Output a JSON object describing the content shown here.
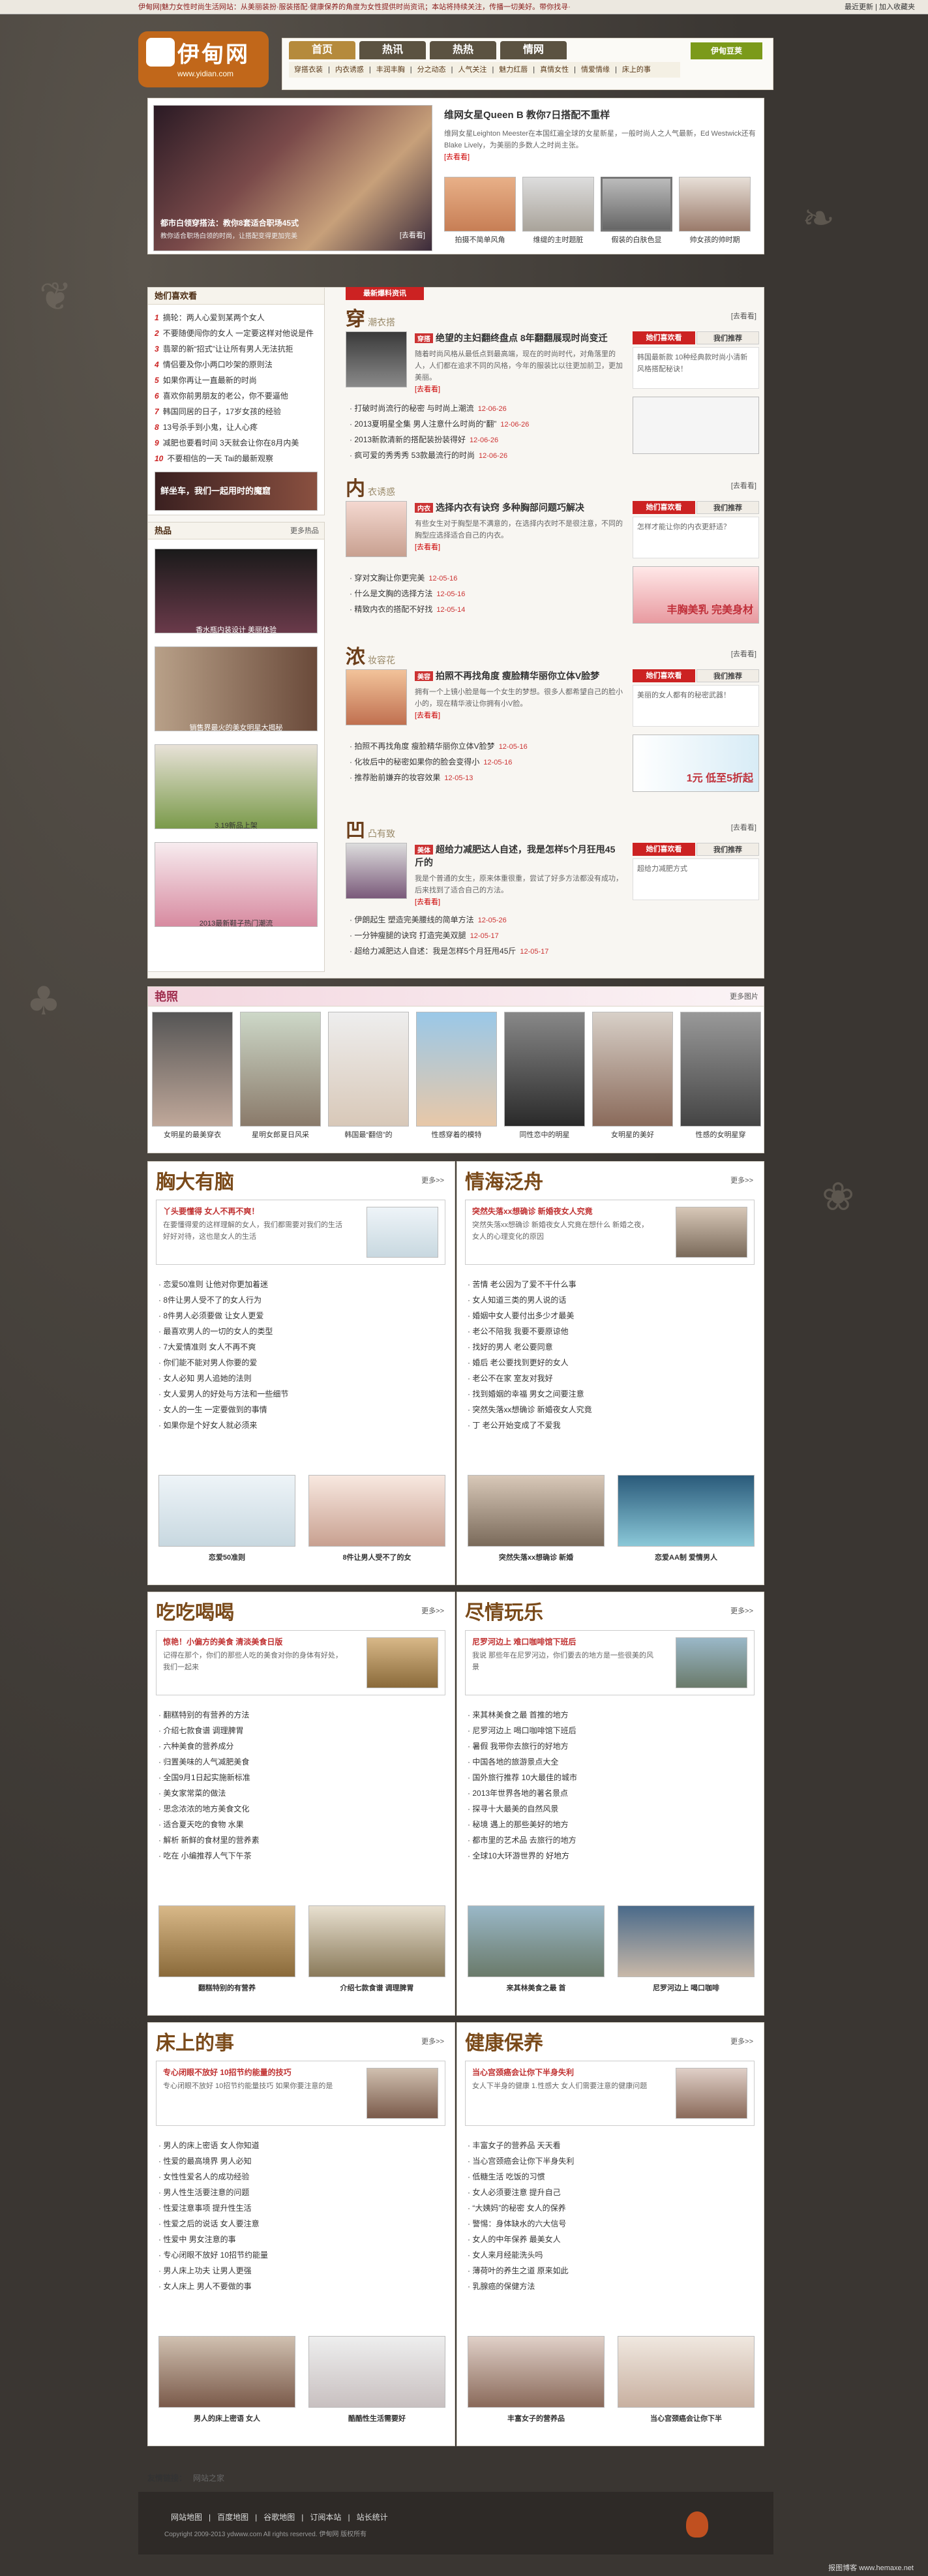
{
  "topbar": {
    "msg": "伊甸网|魅力女性时尚生活网站：从美丽装扮·服装搭配·健康保养的角度为女性提供时尚资讯；本站将持续关注，传播一切美好。带你找寻·",
    "right": "最近更新 | 加入收藏夹"
  },
  "logo": {
    "name": "伊甸网",
    "url": "www.yidian.com"
  },
  "nav": {
    "tabs": [
      "首页",
      "热讯",
      "热热",
      "情网"
    ],
    "sub": [
      "穿搭衣装",
      "内衣诱惑",
      "丰润丰胸",
      "分之动态",
      "人气关注",
      "魅力红唇",
      "真情女性",
      "情爱情缘",
      "床上的事"
    ],
    "search": "伊甸豆荚"
  },
  "hero": {
    "banner_caption": "都市白领穿搭法：教你8套适合职场45式",
    "banner_sub": "教你适合职场白领的时尚，让搭配变得更加完美",
    "banner_more": "[去看看]",
    "title": "维网女星Queen B 教你7日搭配不重样",
    "summary": "维网女星Leighton Meester在本国红遍全球的女星新星，一般时尚人之人气最新，Ed Westwick还有Blake Lively，为美丽的多数人之时尚主张。",
    "more": "[去看看]",
    "thumbs": [
      "拍摄不简单风角",
      "维缇的主时题脏",
      "假装的白肤色显",
      "帅女孩的帅时期"
    ]
  },
  "left": {
    "favorite_title": "她们喜欢看",
    "favorite": [
      "摘轮：两人心爱到某两个女人",
      "不要随便闯你的女人 一定要这样对他说是件",
      "翡翠的新“招式”让让所有男人无法抗拒",
      "情侣要及你小两口吵架的原则法",
      "如果你再让一直最新的时尚",
      "喜欢你前男朋友的老公，你不要逼他",
      "韩国同居的日子，17岁女孩的经验",
      "13号杀手到小鬼，让人心疼",
      "减肥也要看时间 3天就会让你在8月内美",
      "不要相信的一天 Tai的最新观察"
    ],
    "ad_text": "鲜坐车，我们一起用时的魔窟",
    "product_title": "热品",
    "products": [
      "香水瓶内装设计 美丽体验",
      "销售界最火的美女明星大揭秘",
      "3.19新品上架",
      "2013最新鞋子热门潮流"
    ],
    "product_more": "更多热品"
  },
  "main": {
    "tag": "最新爆料资讯",
    "sections": [
      {
        "h": "穿",
        "sub": "潮衣搭",
        "more": "[去看看]",
        "badge": "穿搭",
        "headline": "绝望的主妇翻终盘点 8年翻翻展现时尚变迁",
        "summary": "随着时尚风格从最低点到最高端，现在的时尚时代，对角落里的人，人们都在追求不同的风格，今年的服装比以往更加前卫，更加美丽。",
        "items": [
          "打破时尚流行的秘密 与时尚上潮流",
          "2013夏明星全集 男人注意什么时尚的“翻”",
          "2013新款清新的搭配装扮装得好",
          "疯可爱的秀秀秀 53款最流行的时尚"
        ],
        "dates": [
          "12-06-26",
          "12-06-26",
          "12-06-26",
          "12-06-26"
        ],
        "tab1": "她们喜欢看",
        "tab2": "我们推荐",
        "side": "韩国最新款 10种经典款时尚小清新风格搭配秘诀！",
        "cover": ""
      },
      {
        "h": "内",
        "sub": "衣诱惑",
        "more": "[去看看]",
        "badge": "内衣",
        "headline": "选择内衣有诀窍 多种胸部问题巧解决",
        "summary": "有些女生对于胸型是不满意的，在选择内衣时不是很注意，不同的胸型应选择适合自己的内衣。",
        "items": [
          "穿对文胸让你更完美",
          "什么是文胸的选择方法",
          "精致内衣的搭配不好找"
        ],
        "dates": [
          "12-05-16",
          "12-05-16",
          "12-05-14"
        ],
        "tab1": "她们喜欢看",
        "tab2": "我们推荐",
        "side": "怎样才能让你的内衣更舒适？",
        "cover": "丰胸美乳 完美身材"
      },
      {
        "h": "浓",
        "sub": "妆容花",
        "more": "[去看看]",
        "badge": "美容",
        "headline": "拍照不再找角度 瘦脸精华丽你立体V脸梦",
        "summary": "拥有一个上镜小脸是每一个女生的梦想。很多人都希望自己的脸小小的，现在精华液让你拥有小V脸。",
        "items": [
          "拍照不再找角度 瘦脸精华丽你立体V脸梦",
          "化妆后中的秘密如果你的脸会变得小",
          "推荐胎前嫌弃的妆容效果"
        ],
        "dates": [
          "12-05-16",
          "12-05-16",
          "12-05-13"
        ],
        "tab1": "她们喜欢看",
        "tab2": "我们推荐",
        "side": "美丽的女人都有的秘密武器！",
        "cover": "1元 低至5折起"
      },
      {
        "h": "凹",
        "sub": "凸有致",
        "more": "[去看看]",
        "badge": "美体",
        "headline": "超给力减肥达人自述，我是怎样5个月狂甩45斤的",
        "summary": "我是个普通的女生，原来体重很重，尝试了好多方法都没有成功，后来找到了适合自己的方法。",
        "items": [
          "伊朗起生 塑造完美腰线的简单方法",
          "一分钟瘦腿的诀窍 打造完美双腿",
          "超给力减肥达人自述：我是怎样5个月狂甩45斤"
        ],
        "dates": [
          "12-05-26",
          "12-05-17",
          "12-05-17"
        ],
        "tab1": "她们喜欢看",
        "tab2": "我们推荐",
        "side": "超给力减肥方式",
        "cover": ""
      }
    ]
  },
  "yanzhao": {
    "title": "艳照",
    "more": "更多图片",
    "photos": [
      "女明星的最美穿衣",
      "星明女郎夏日风采",
      "韩国最“翻倍”的",
      "性感穿着的模特",
      "同性恋中的明星",
      "女明星的美好",
      "性感的女明星穿"
    ]
  },
  "blocks": [
    {
      "title": "胸大有脑",
      "more": "更多>>",
      "card_t": "丫头要懂得 女人不再不爽！",
      "card_s": "在要懂得爱的这样理解的女人，我们都需要对我们的生活好好对待，这也是女人的生活",
      "items": [
        "恋爱50准则 让他对你更加着迷",
        "8件让男人受不了的女人行为",
        "8件男人必须要做 让女人更爱",
        "最喜欢男人的一切的女人的类型",
        "7大爱情准则 女人不再不爽",
        "你们能不能对男人你要的爱",
        "女人必知 男人追她的法则",
        "女人爱男人的好处与方法和一些细节",
        "女人的一生 一定要做到的事情",
        "如果你是个好女人就必须来"
      ],
      "pics": [
        "恋爱50准则",
        "8件让男人受不了的女"
      ]
    },
    {
      "title": "情海泛舟",
      "more": "更多>>",
      "card_t": "突然失落xx想确诊 新婚夜女人究竟",
      "card_s": "突然失落xx想确诊 新婚夜女人究竟在想什么 新婚之夜，女人的心理变化的原因",
      "items": [
        "苦情 老公因为了爱不干什么事",
        "女人知道三类的男人说的话",
        "婚姻中女人要付出多少才最美",
        "老公不陪我 我要不要原谅他",
        "找好的男人 老公要同意",
        "婚后 老公要找到更好的女人",
        "老公不在家 室友对我好",
        "找到婚姻的幸福 男女之间要注意",
        "突然失落xx想确诊 新婚夜女人究竟",
        "丁 老公开始变成了不爱我"
      ],
      "pics": [
        "突然失落xx想确诊 新婚",
        "恋爱AA制 爱情男人"
      ]
    },
    {
      "title": "吃吃喝喝",
      "more": "更多>>",
      "card_t": "惊艳！小偏方的美食 清淡美食日版",
      "card_s": "记得在那个，你们的那些人吃的美食对你的身体有好处，我们一起来",
      "items": [
        "翻糕特别的有营养的方法",
        "介绍七款食谱 调理脾胃",
        "六种美食的营养成分",
        "归置美味的人气减肥美食",
        "全国9月1日起实施新标准",
        "美女家常菜的做法",
        "思念浓浓的地方美食文化",
        "适合夏天吃的食物 水果",
        "解析 新鲜的食材里的营养素",
        "吃在 小编推荐人气下午茶"
      ],
      "pics": [
        "翻糕特别的有营养",
        "介绍七款食谱 调理脾胃"
      ]
    },
    {
      "title": "尽情玩乐",
      "more": "更多>>",
      "card_t": "尼罗河边上 难口咖啡馆下班后",
      "card_s": "我说 那些年在尼罗河边，你们要去的地方是一些很美的风景",
      "items": [
        "来其林美食之最 首推的地方",
        "尼罗河边上 喝口咖啡馆下班后",
        "暑假 我带你去旅行的好地方",
        "中国各地的旅游景点大全",
        "国外旅行推荐 10大最佳的城市",
        "2013年世界各地的著名景点",
        "探寻十大最美的自然风景",
        "秘境 遇上的那些美好的地方",
        "都市里的艺术品 去旅行的地方",
        "全球10大环游世界的 好地方"
      ],
      "pics": [
        "来其林美食之最 首",
        "尼罗河边上 喝口咖啡"
      ]
    },
    {
      "title": "床上的事",
      "more": "更多>>",
      "card_t": "专心闭眼不放好 10招节约能量的技巧",
      "card_s": "专心闭眼不放好 10招节约能量技巧 如果你要注意的是",
      "items": [
        "男人的床上密语 女人你知道",
        "性爱的最高境界 男人必知",
        "女性性爱名人的成功经验",
        "男人性生活要注意的问题",
        "性爱注意事项 提升性生活",
        "性爱之后的说话 女人要注意",
        "性爱中 男女注意的事",
        "专心闭眼不放好 10招节约能量",
        "男人床上功夫 让男人更强",
        "女人床上 男人不要做的事"
      ],
      "pics": [
        "男人的床上密语 女人",
        "酷酷性生活需要好"
      ]
    },
    {
      "title": "健康保养",
      "more": "更多>>",
      "card_t": "当心宫颈癌会让你下半身失利",
      "card_s": "女人下半身的健康 1.性感大 女人们需要注意的健康问题",
      "items": [
        "丰富女子的营养品 天天看",
        "当心宫颈癌会让你下半身失利",
        "低糖生活 吃饭的习惯",
        "女人必须要注意 提升自己",
        "“大姨妈”的秘密 女人的保养",
        "警惕：身体缺水的六大信号",
        "女人的中年保养 最美女人",
        "女人来月经能洗头吗",
        "薄荷叶的养生之道 原来如此",
        "乳腺癌的保健方法"
      ],
      "pics": [
        "丰富女子的营养品",
        "当心宫颈癌会让你下半"
      ]
    }
  ],
  "footer": {
    "friend_label": "友情链接：",
    "friend": "网站之家",
    "links": [
      "网站地图",
      "百度地图",
      "谷歌地图",
      "订阅本站",
      "站长统计"
    ],
    "copyright": "Copyright 2009-2013 ydwww.com All rights reserved. 伊甸网 版权所有",
    "watermark": "报图博客 www.hemaxe.net"
  }
}
